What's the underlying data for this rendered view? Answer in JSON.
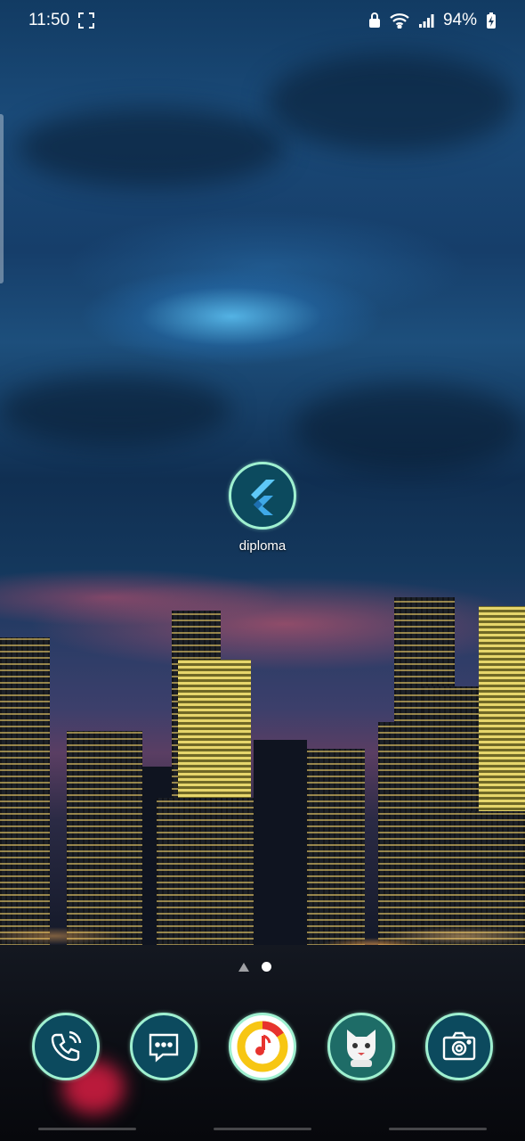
{
  "status_bar": {
    "time": "11:50",
    "battery": "94%",
    "icons": [
      "screenshot-frame-icon",
      "lock-icon",
      "wifi-icon",
      "signal-icon",
      "battery-charging-icon"
    ]
  },
  "home": {
    "apps": [
      {
        "label": "diploma",
        "icon": "flutter-icon"
      }
    ],
    "page_indicator": {
      "pages": 1,
      "current": 1
    }
  },
  "dock": {
    "apps": [
      {
        "icon": "phone-icon"
      },
      {
        "icon": "messages-icon"
      },
      {
        "icon": "music-icon"
      },
      {
        "icon": "cat-mascot-icon"
      },
      {
        "icon": "camera-icon"
      }
    ]
  },
  "colors": {
    "icon_ring": "#9ff0d0",
    "icon_fill": "#0c4a5e"
  }
}
